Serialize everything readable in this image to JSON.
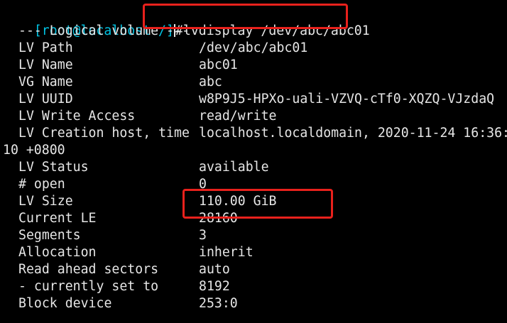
{
  "terminal": {
    "prompt": "[root@localhost /]",
    "command": "#lvdisplay /dev/abc/abc01",
    "header": "--- Logical volume ---",
    "rows": [
      {
        "label": "LV Path",
        "value": "/dev/abc/abc01"
      },
      {
        "label": "LV Name",
        "value": "abc01"
      },
      {
        "label": "VG Name",
        "value": "abc"
      },
      {
        "label": "LV UUID",
        "value": "w8P9J5-HPXo-uali-VZVQ-cTf0-XQZQ-VJzdaQ"
      },
      {
        "label": "LV Write Access",
        "value": "read/write"
      },
      {
        "label": "LV Creation host, time",
        "value": "localhost.localdomain, 2020-11-24 16:36:"
      },
      {
        "label": "",
        "value": "10 +0800"
      },
      {
        "label": "LV Status",
        "value": "available"
      },
      {
        "label": "# open",
        "value": "0"
      },
      {
        "label": "LV Size",
        "value": "110.00 GiB"
      },
      {
        "label": "Current LE",
        "value": "28160"
      },
      {
        "label": "Segments",
        "value": "3"
      },
      {
        "label": "Allocation",
        "value": "inherit"
      },
      {
        "label": "Read ahead sectors",
        "value": "auto"
      },
      {
        "label": "- currently set to",
        "value": "8192"
      },
      {
        "label": "Block device",
        "value": "253:0"
      }
    ]
  },
  "colors": {
    "background": "#000000",
    "text": "#e6e6e6",
    "prompt": "#00c3e3",
    "annotation_box": "#e8211c"
  }
}
